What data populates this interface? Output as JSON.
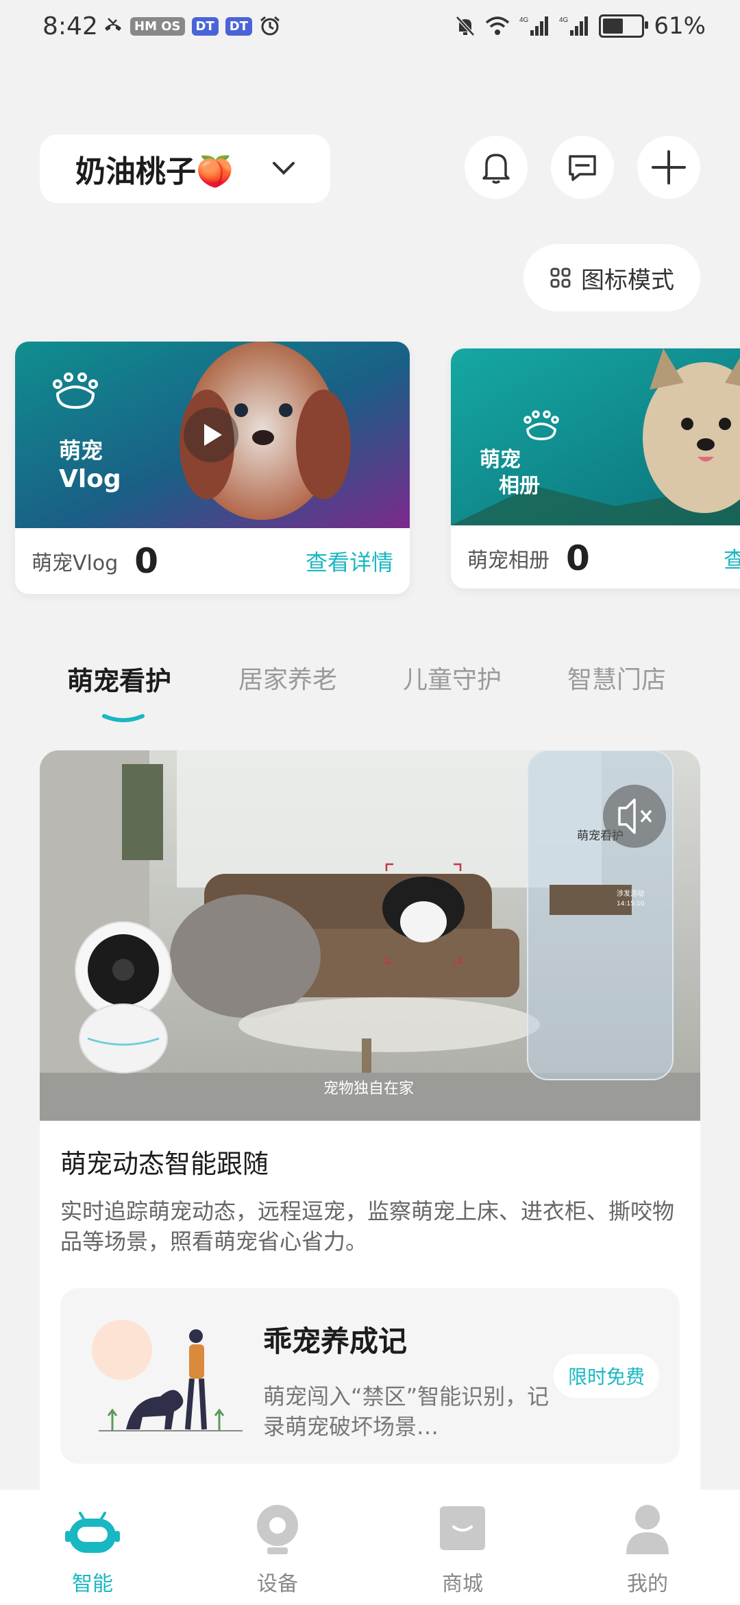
{
  "status_bar": {
    "time": "8:42",
    "chips": [
      "HM OS",
      "DT",
      "DT"
    ],
    "battery_percent": "61%",
    "battery_level": 0.61
  },
  "header": {
    "account_name": "奶油桃子🍑",
    "view_mode_label": "图标模式"
  },
  "cards": [
    {
      "image_title_line1": "萌宠",
      "image_title_line2": "Vlog",
      "label": "萌宠Vlog",
      "count": "0",
      "link": "查看详情"
    },
    {
      "image_title_line1": "萌宠",
      "image_title_line2": "相册",
      "label": "萌宠相册",
      "count": "0",
      "link": "查"
    }
  ],
  "tabs": [
    {
      "label": "萌宠看护",
      "active": true
    },
    {
      "label": "居家养老",
      "active": false
    },
    {
      "label": "儿童守护",
      "active": false
    },
    {
      "label": "智慧门店",
      "active": false
    }
  ],
  "feature": {
    "video_caption": "宠物独自在家",
    "overlay_title": "萌宠看护",
    "overlay_item_label": "涉发活动",
    "overlay_item_time": "14:15:10",
    "title": "萌宠动态智能跟随",
    "description": "实时追踪萌宠动态，远程逗宠，监察萌宠上床、进衣柜、撕咬物品等场景，照看萌宠省心省力。"
  },
  "promo": {
    "title": "乖宠养成记",
    "description": "萌宠闯入“禁区”智能识别，记录萌宠破坏场景…",
    "badge": "限时免费"
  },
  "bottom_nav": [
    {
      "label": "智能",
      "icon": "robot-icon",
      "active": true
    },
    {
      "label": "设备",
      "icon": "camera-icon",
      "active": false
    },
    {
      "label": "商城",
      "icon": "shop-bag-icon",
      "active": false
    },
    {
      "label": "我的",
      "icon": "person-icon",
      "active": false
    }
  ],
  "colors": {
    "accent": "#19b7c2",
    "background": "#f2f2f2",
    "card": "#ffffff"
  }
}
